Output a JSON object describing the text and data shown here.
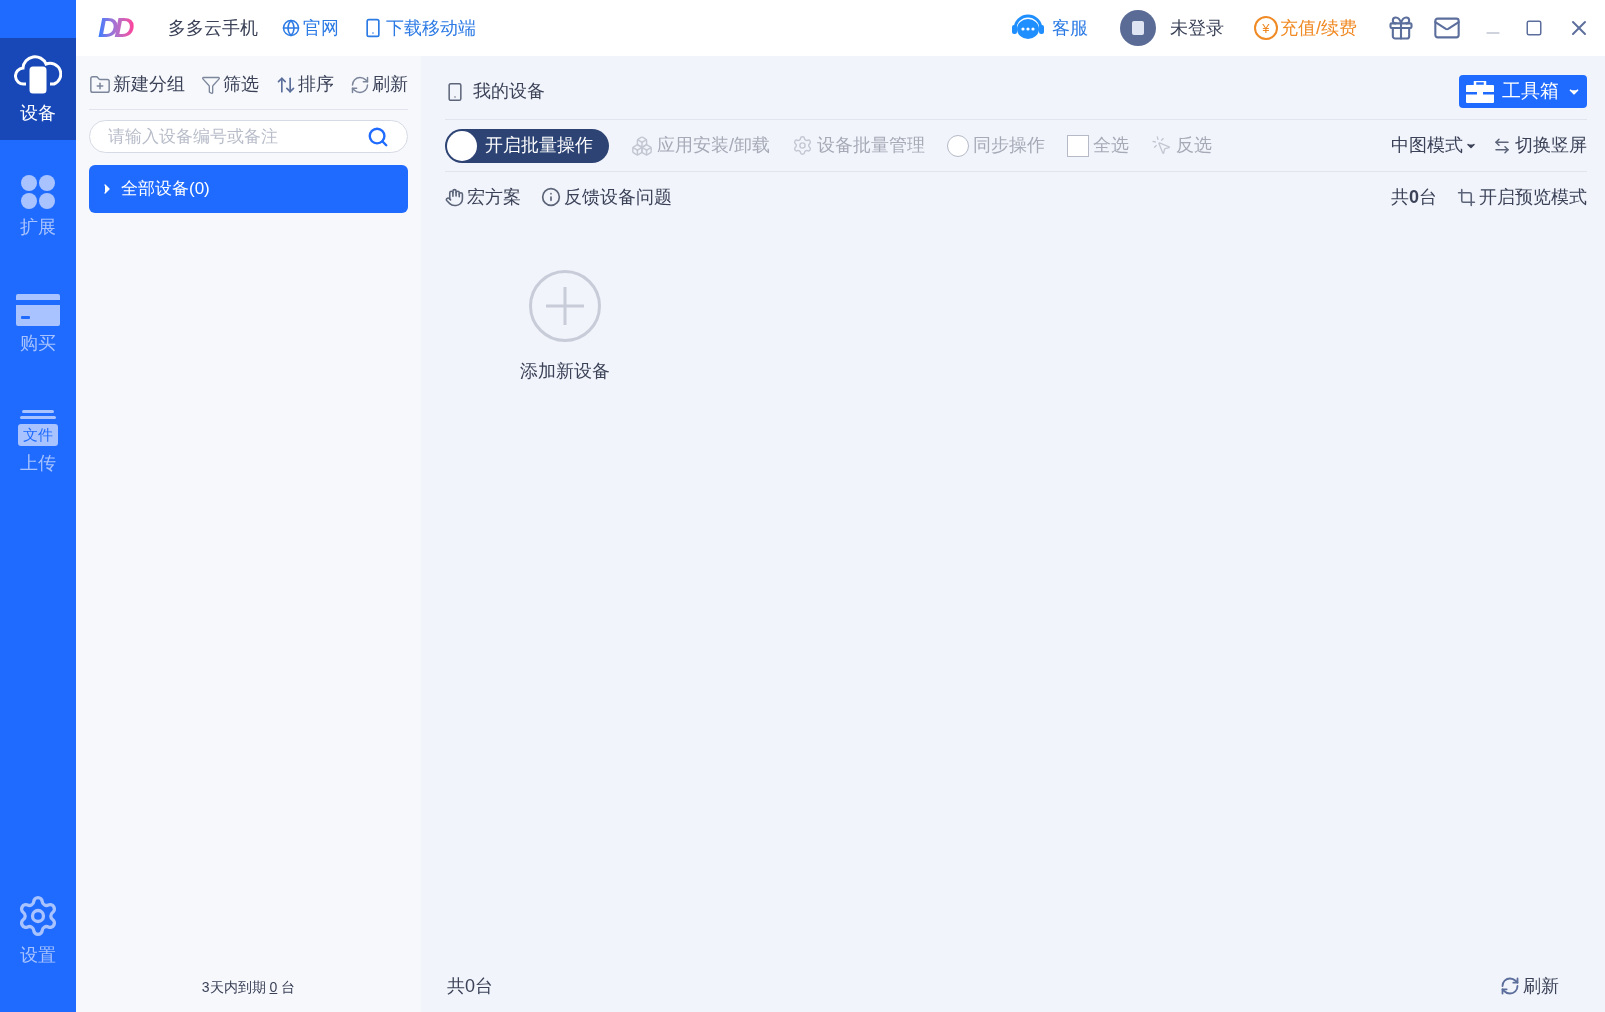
{
  "app": {
    "logo": "DD",
    "name": "多多云手机",
    "links": [
      {
        "label": "官网",
        "kind": "globe"
      },
      {
        "label": "下载移动端",
        "kind": "phone"
      }
    ]
  },
  "header": {
    "support": "客服",
    "user": "未登录",
    "recharge_icon": "¥",
    "recharge": "充值/续费"
  },
  "nav": [
    {
      "label": "设备",
      "kind": "device",
      "selected": true
    },
    {
      "label": "扩展",
      "kind": "extend",
      "selected": false
    },
    {
      "label": "购买",
      "kind": "card",
      "selected": false
    },
    {
      "label": "上传",
      "kind": "upload",
      "icon_text": "文件",
      "selected": false
    },
    {
      "label": "设置",
      "kind": "settings",
      "selected": false
    }
  ],
  "group_toolbar": [
    {
      "label": "新建分组",
      "kind": "new-group"
    },
    {
      "label": "筛选",
      "kind": "filter"
    },
    {
      "label": "排序",
      "kind": "sort"
    },
    {
      "label": "刷新",
      "kind": "refresh"
    }
  ],
  "search": {
    "placeholder": "请输入设备编号或备注"
  },
  "groups": [
    {
      "label": "全部设备(0)",
      "selected": true,
      "expanded": false
    }
  ],
  "expiry": {
    "prefix": "3天内到期",
    "count": "0",
    "suffix": "台"
  },
  "main": {
    "title": "我的设备",
    "toolbox": "工具箱",
    "batch_toggle": {
      "label": "开启批量操作",
      "on": false
    },
    "batch_actions": [
      {
        "label": "应用安装/卸载",
        "kind": "apps",
        "disabled": true
      },
      {
        "label": "设备批量管理",
        "kind": "gear",
        "disabled": true
      },
      {
        "label": "同步操作",
        "kind": "radio",
        "checked": false,
        "disabled": true
      },
      {
        "label": "全选",
        "kind": "checkbox",
        "checked": false,
        "disabled": true
      },
      {
        "label": "反选",
        "kind": "invert",
        "disabled": true
      }
    ],
    "view_mode": "中图模式",
    "switch_screen": "切换竖屏",
    "secondary": [
      {
        "label": "宏方案",
        "kind": "hand"
      },
      {
        "label": "反馈设备问题",
        "kind": "info"
      }
    ],
    "count": "共**0**台",
    "preview": "开启预览模式",
    "add_device": "添加新设备",
    "footer": {
      "count": "共0台",
      "refresh": "刷新"
    }
  }
}
